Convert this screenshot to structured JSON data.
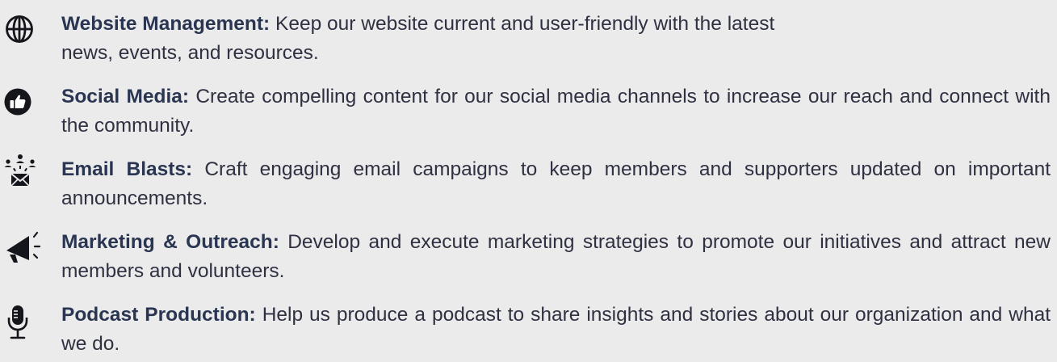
{
  "items": [
    {
      "icon": "globe-icon",
      "heading": "Website Management:",
      "body": " Keep our website current and user-friendly with the latest",
      "body2": "news, events, and resources."
    },
    {
      "icon": "thumbs-up-icon",
      "heading": "Social Media:",
      "body": " Create compelling content for our social media channels to increase our reach and connect with the community."
    },
    {
      "icon": "email-blast-icon",
      "heading": "Email Blasts:",
      "body": " Craft engaging email campaigns to keep members and supporters updated  on important announcements."
    },
    {
      "icon": "megaphone-icon",
      "heading": "Marketing & Outreach:",
      "body": " Develop and execute marketing strategies to promote our initiatives and attract new members and volunteers."
    },
    {
      "icon": "microphone-icon",
      "heading": "Podcast Production:",
      "body": " Help us produce a podcast to share insights and stories about our organization and what we do."
    }
  ]
}
